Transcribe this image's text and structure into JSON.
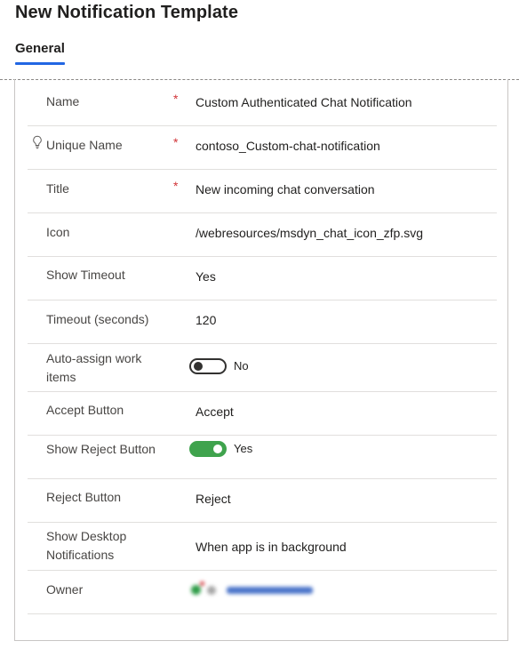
{
  "page": {
    "title": "New Notification Template"
  },
  "tabs": [
    {
      "label": "General",
      "selected": true
    }
  ],
  "fields": {
    "name": {
      "label": "Name",
      "value": "Custom Authenticated Chat Notification",
      "required": "*"
    },
    "unique_name": {
      "label": "Unique Name",
      "value": "contoso_Custom-chat-notification",
      "required": "*"
    },
    "title": {
      "label": "Title",
      "value": "New incoming chat conversation",
      "required": "*"
    },
    "icon": {
      "label": "Icon",
      "value": "/webresources/msdyn_chat_icon_zfp.svg"
    },
    "show_timeout": {
      "label": "Show Timeout",
      "value": "Yes"
    },
    "timeout_seconds": {
      "label": "Timeout (seconds)",
      "value": "120"
    },
    "auto_assign": {
      "label": "Auto-assign work items",
      "value": "No",
      "toggle_on": false
    },
    "accept_button": {
      "label": "Accept Button",
      "value": "Accept"
    },
    "show_reject_button": {
      "label": "Show Reject Button",
      "value": "Yes",
      "toggle_on": true
    },
    "reject_button": {
      "label": "Reject Button",
      "value": "Reject"
    },
    "show_desktop_notifications": {
      "label": "Show Desktop Notifications",
      "value": "When app is in background"
    },
    "owner": {
      "label": "Owner"
    }
  },
  "icons": {
    "unique_name_hint": "lightbulb-icon",
    "owner_avatar": "user-avatar-icon"
  },
  "colors": {
    "accent": "#2266e3",
    "required": "#d13438",
    "toggle_on": "#3fa34d"
  }
}
